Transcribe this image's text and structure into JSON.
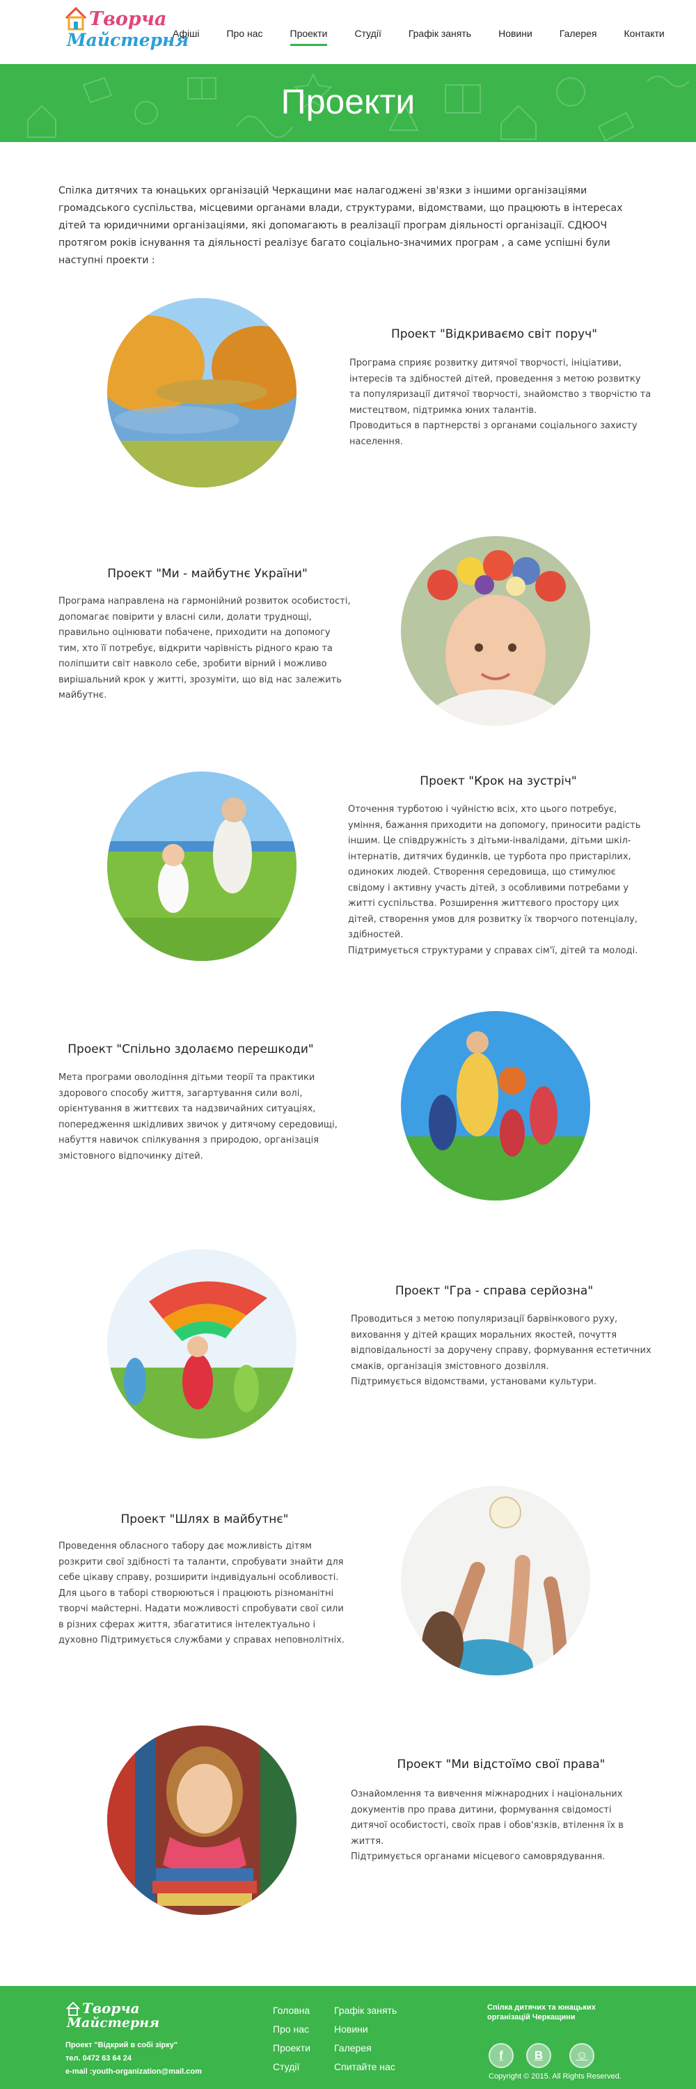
{
  "logo": {
    "line1": "Творча",
    "line2": "Майстерня"
  },
  "nav": [
    {
      "label": "Афіші"
    },
    {
      "label": "Про нас"
    },
    {
      "label": "Проекти"
    },
    {
      "label": "Студії"
    },
    {
      "label": "Графік занять"
    },
    {
      "label": "Новини"
    },
    {
      "label": "Галерея"
    },
    {
      "label": "Контакти"
    }
  ],
  "banner": {
    "title": "Проекти"
  },
  "intro": "Спілка дитячих та юнацьких організацій Черкащини має налагоджені зв'язки з іншими організаціями громадського суспільства, місцевими органами влади, структурами, відомствами, що працюють в інтересах дітей та юридичними організаціями, які допомагають в реалізації програм діяльності організації.  СДЮОЧ протягом років існування та діяльності реалізує багато  соціально-значимих програм , а саме  успішні були наступні проекти  :",
  "projects": [
    {
      "title": "Проект \"Відкриваємо світ поруч\"",
      "image": "autumn-lake-photo",
      "paragraphs": [
        "Програма сприяє розвитку дитячої творчості, ініціативи, інтересів та здібностей дітей, проведення з метою розвитку та популяризації дитячої творчості, знайомство з творчістю та мистецтвом, підтримка юних талантів.",
        "Проводиться в партнерстві з органами соціального захисту населення."
      ]
    },
    {
      "title": "Проект \"Ми - майбутнє України\"",
      "image": "child-flower-wreath-photo",
      "paragraphs": [
        "Програма направлена на гармонійний розвиток особистості, допомагає повірити у власні сили, долати труднощі, правильно оцінювати побачене, приходити на допомогу тим, хто її потребує, відкрити чарівність рідного краю та поліпшити світ навколо себе, зробити вірний і можливо вирішальний крок у житті, зрозуміти, що від нас залежить майбутнє."
      ]
    },
    {
      "title": "Проект \"Крок на зустріч\"",
      "image": "mother-child-meadow-photo",
      "paragraphs": [
        "Оточення турботою і чуйністю всіх, хто цього потребує, уміння, бажання приходити на допомогу, приносити радість іншим. Це співдружність з дітьми-інвалідами, дітьми шкіл-інтернатів, дитячих будинків, це турбота про пристарілих, одиноких людей. Створення середовища, що стимулює свідому і активну участь дітей, з особливими потребами у житті суспільства. Розширення життєвого простору цих дітей, створення умов для розвитку їх творчого потенціалу, здібностей.",
        "Підтримується структурами у справах сім'ї, дітей та молоді."
      ]
    },
    {
      "title": "Проект \"Спільно здолаємо перешкоди\"",
      "image": "kids-running-ball-photo",
      "paragraphs": [
        "Мета програми оволодіння дітьми теорії та практики здорового способу життя, загартування сили волі, орієнтування в життєвих та надзвичайних ситуаціях, попередження шкідливих звичок у дитячому середовищі, набуття навичок спілкування з природою, організація змістовного відпочинку дітей."
      ]
    },
    {
      "title": "Проект \"Гра - справа серйозна\"",
      "image": "kids-flying-kite-photo",
      "paragraphs": [
        "Проводиться з метою популяризації барвінкового руху, виховання у дітей кращих моральних якостей, почуття відповідальності за доручену справу, формування естетичних смаків, організація змістовного дозвілля.",
        "Підтримується відомствами, установами культури."
      ]
    },
    {
      "title": "Проект \"Шлях в майбутнє\"",
      "image": "volleyball-hands-photo",
      "paragraphs": [
        "Проведення обласного табору дає можливість дітям розкрити свої здібності та таланти, спробувати знайти для себе цікаву справу, розширити індивідуальні особливості. Для цього в таборі створюються і працюють різноманітні творчі майстерні. Надати можливості спробувати свої сили в різних сферах життя, збагатитися інтелектуально і духовно Підтримується службами у справах неповнолітніх."
      ]
    },
    {
      "title": "Проект \"Ми відстоїмо свої права\"",
      "image": "girl-with-books-photo",
      "paragraphs": [
        "Ознайомлення та вивчення міжнародних і національних документів про права дитини, формування свідомості дитячої особистості, своїх прав і обов'язків, втілення їх в життя.",
        "Підтримується органами місцевого самоврядування."
      ]
    }
  ],
  "footer": {
    "logo_line1": "Творча",
    "logo_line2": "Майстерня",
    "project_line": "Проект \"Відкрий в собі зірку\"",
    "phone_line": "тел. 0472 63 64 24",
    "email_line": "e-mail :youth-organization@mail.com",
    "nav_col1": [
      {
        "label": "Головна"
      },
      {
        "label": "Про нас"
      },
      {
        "label": "Проекти"
      },
      {
        "label": "Студії"
      }
    ],
    "nav_col2": [
      {
        "label": "Графік занять"
      },
      {
        "label": "Новини"
      },
      {
        "label": "Галерея"
      },
      {
        "label": "Спитайте нас"
      }
    ],
    "org": "Спілка дитячих та юнацьких організацій Черкащини",
    "social": [
      {
        "icon": "facebook-icon",
        "label": "f"
      },
      {
        "icon": "vkontakte-icon",
        "label": "B"
      },
      {
        "icon": "odnoklassniki-icon",
        "label": "☺"
      }
    ],
    "copyright": "Copyright © 2015.  All Rights Reserved."
  }
}
